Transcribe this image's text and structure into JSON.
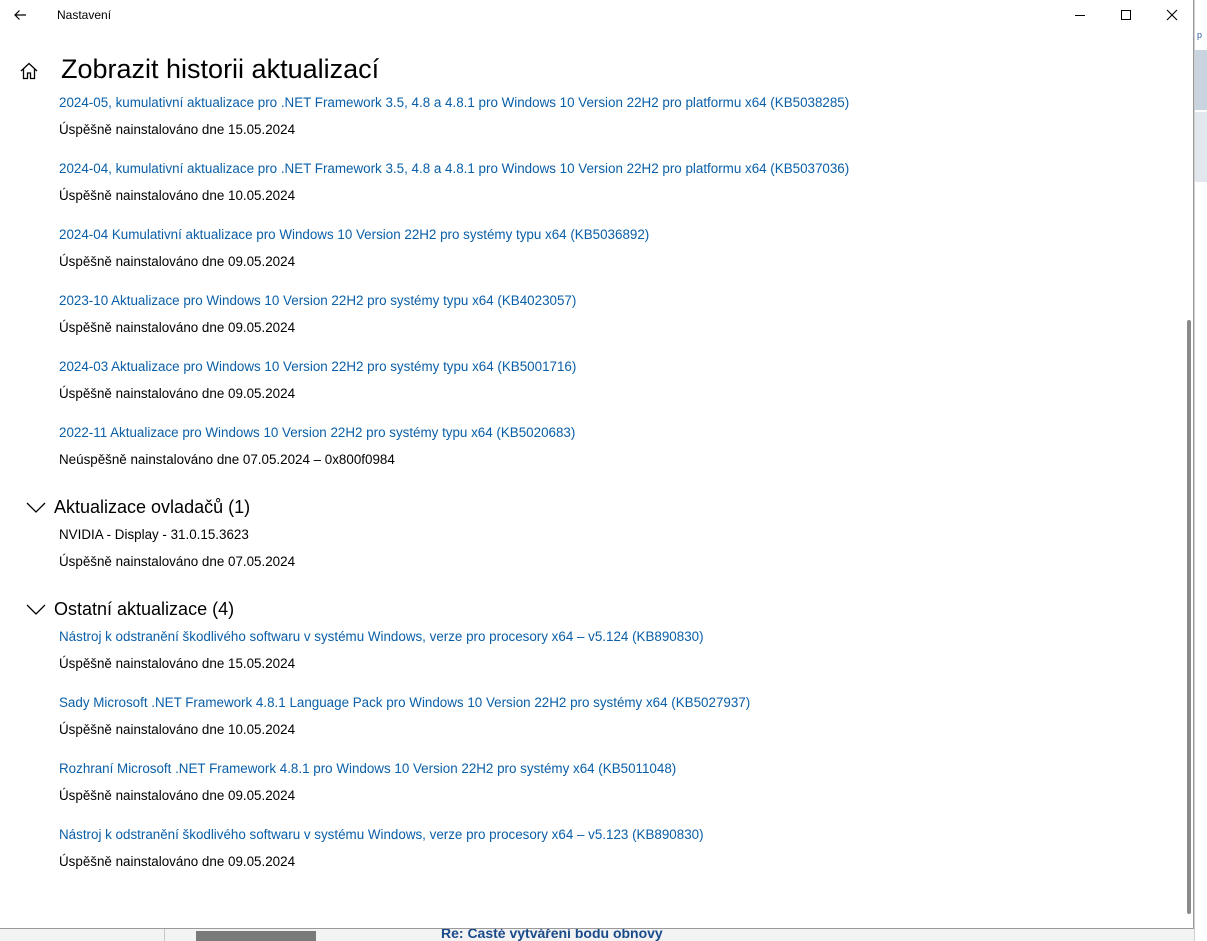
{
  "window": {
    "app_title": "Nastavení",
    "page_title": "Zobrazit historii aktualizací"
  },
  "quality_updates": [
    {
      "title": "2024-05, kumulativní aktualizace pro .NET Framework 3.5, 4.8 a 4.8.1 pro Windows 10 Version 22H2 pro platformu x64 (KB5038285)",
      "status": "Úspěšně nainstalováno dne 15.05.2024"
    },
    {
      "title": "2024-04, kumulativní aktualizace pro .NET Framework 3.5, 4.8 a 4.8.1 pro Windows 10 Version 22H2 pro platformu x64 (KB5037036)",
      "status": "Úspěšně nainstalováno dne 10.05.2024"
    },
    {
      "title": "2024-04 Kumulativní aktualizace pro Windows 10 Version 22H2 pro systémy typu x64 (KB5036892)",
      "status": "Úspěšně nainstalováno dne 09.05.2024"
    },
    {
      "title": "2023-10 Aktualizace pro Windows 10 Version 22H2 pro systémy typu x64 (KB4023057)",
      "status": "Úspěšně nainstalováno dne 09.05.2024"
    },
    {
      "title": "2024-03 Aktualizace pro Windows 10 Version 22H2 pro systémy typu x64 (KB5001716)",
      "status": "Úspěšně nainstalováno dne 09.05.2024"
    },
    {
      "title": "2022-11 Aktualizace pro Windows 10 Version 22H2 pro systémy typu x64 (KB5020683)",
      "status": "Neúspěšně nainstalováno dne 07.05.2024 – 0x800f0984"
    }
  ],
  "driver_section": {
    "title": "Aktualizace ovladačů (1)",
    "items": [
      {
        "title": "NVIDIA - Display - 31.0.15.3623",
        "status": "Úspěšně nainstalováno dne 07.05.2024"
      }
    ]
  },
  "other_section": {
    "title": "Ostatní aktualizace (4)",
    "items": [
      {
        "title": "Nástroj k odstranění škodlivého softwaru v systému Windows, verze pro procesory x64 – v5.124 (KB890830)",
        "status": "Úspěšně nainstalováno dne 15.05.2024"
      },
      {
        "title": "Sady Microsoft .NET Framework 4.8.1 Language Pack pro Windows 10 Version 22H2 pro systémy x64 (KB5027937)",
        "status": "Úspěšně nainstalováno dne 10.05.2024"
      },
      {
        "title": "Rozhraní Microsoft .NET Framework 4.8.1 pro Windows 10 Version 22H2 pro systémy x64 (KB5011048)",
        "status": "Úspěšně nainstalováno dne 09.05.2024"
      },
      {
        "title": "Nástroj k odstranění škodlivého softwaru v systému Windows, verze pro procesory x64 – v5.123 (KB890830)",
        "status": "Úspěšně nainstalováno dne 09.05.2024"
      }
    ]
  },
  "background": {
    "bottom_link": "Re: Časté vytváření bodu obnovy",
    "right_tab": "p"
  },
  "colors": {
    "link": "#0a5fa8",
    "text": "#000000",
    "background": "#ffffff"
  }
}
